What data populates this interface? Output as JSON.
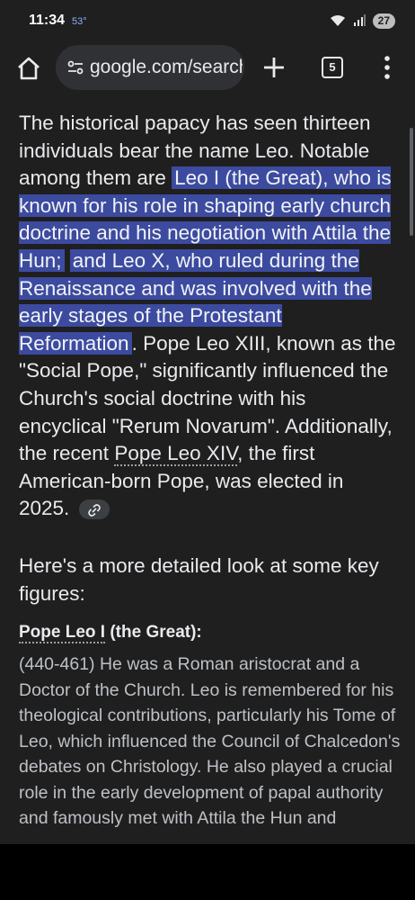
{
  "status": {
    "time": "11:34",
    "temp": "53°",
    "battery": "27"
  },
  "toolbar": {
    "url": "google.com/search",
    "tab_count": "5"
  },
  "article": {
    "p1_a": "The historical papacy has seen thirteen individuals bear the name Leo. Notable among them are",
    "p1_hl1": "Leo I (the Great), who is known for his role in shaping early church doctrine and his negotiation with Attila the Hun;",
    "p1_hl2": "and Leo X, who ruled during the Renaissance and was involved with the early stages of the Protestant Reformation",
    "p1_b": ". Pope Leo XIII, known as the \"Social Pope,\" significantly influenced the Church's social doctrine with his encyclical \"Rerum Novarum\". Additionally, the recent",
    "p1_link": "Pope Leo XIV",
    "p1_c": ", the first American-born Pope, was elected in 2025.",
    "subhead": "Here's a more detailed look at some key figures:",
    "figure_title_link": "Pope Leo I",
    "figure_title_rest": " (the Great):",
    "figure_desc": "(440-461) He was a Roman aristocrat and a Doctor of the Church. Leo is remembered for his theological contributions, particularly his Tome of Leo, which influenced the Council of Chalcedon's debates on Christology. He also played a crucial role in the early development of papal authority and famously met with Attila the Hun and"
  }
}
